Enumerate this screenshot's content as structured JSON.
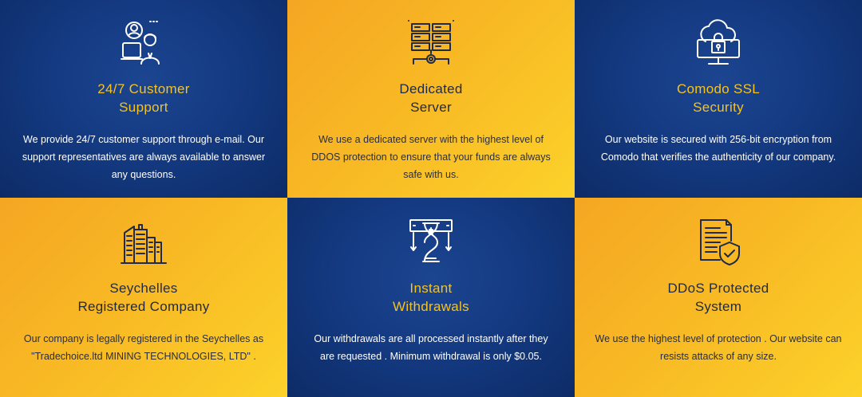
{
  "colors": {
    "navy": "#143a82",
    "gold": "#f8b824",
    "title_gold": "#f6c21c",
    "dark_text": "#1f2a44"
  },
  "features": [
    {
      "icon": "customer-support-icon",
      "title_line1": "24/7 Customer",
      "title_line2": "Support",
      "description": "We provide 24/7 customer support through e-mail. Our support representatives are always available to answer any questions."
    },
    {
      "icon": "server-icon",
      "title_line1": "Dedicated",
      "title_line2": "Server",
      "description": "We use a dedicated server with the highest level of DDOS protection to ensure that your funds are always safe with us."
    },
    {
      "icon": "ssl-lock-icon",
      "title_line1": "Comodo SSL",
      "title_line2": "Security",
      "description": "Our website is secured with 256-bit encryption from Comodo that verifies the authenticity of our company."
    },
    {
      "icon": "company-building-icon",
      "title_line1": "Seychelles",
      "title_line2": "Registered Company",
      "description": "Our company is legally registered in the Seychelles as \"Tradechoice.ltd MINING TECHNOLOGIES, LTD\" ."
    },
    {
      "icon": "instant-withdrawal-icon",
      "title_line1": "Instant",
      "title_line2": "Withdrawals",
      "description": "Our withdrawals are all processed instantly after they are requested . Minimum withdrawal is only $0.05."
    },
    {
      "icon": "ddos-shield-icon",
      "title_line1": "DDoS Protected",
      "title_line2": "System",
      "description": "We use the highest level of protection . Our website can resists attacks of any size."
    }
  ]
}
